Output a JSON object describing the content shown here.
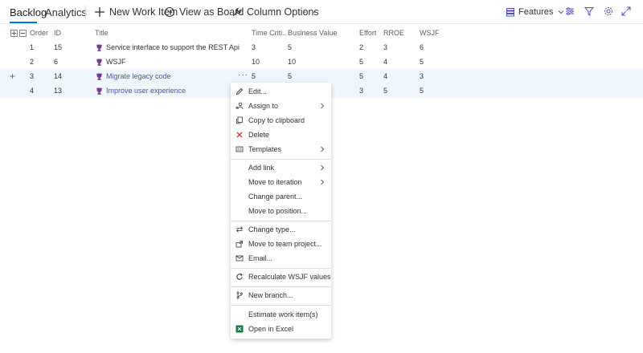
{
  "tabs": [
    {
      "label": "Backlog",
      "active": true
    },
    {
      "label": "Analytics",
      "active": false
    }
  ],
  "toolbar": {
    "new_work_item": "New Work Item",
    "view_as_board": "View as Board",
    "column_options": "Column Options",
    "more": "···",
    "features_label": "Features"
  },
  "columns": [
    "Order",
    "ID",
    "Title",
    "Time Criti...",
    "Business Value",
    "Effort",
    "RROE",
    "WSJF"
  ],
  "rows": [
    {
      "order": "1",
      "id": "15",
      "title": "Service interface to support the REST Api",
      "time": "3",
      "bv": "5",
      "effort": "2",
      "rroe": "3",
      "wsjf": "6",
      "selected": false
    },
    {
      "order": "2",
      "id": "6",
      "title": "WSJF",
      "time": "10",
      "bv": "10",
      "effort": "5",
      "rroe": "4",
      "wsjf": "5",
      "selected": false
    },
    {
      "order": "3",
      "id": "14",
      "title": "Migrate legacy code",
      "time": "5",
      "bv": "5",
      "effort": "5",
      "rroe": "4",
      "wsjf": "3",
      "selected": true
    },
    {
      "order": "4",
      "id": "13",
      "title": "Improve user experience",
      "time": "",
      "bv": "",
      "effort": "3",
      "rroe": "5",
      "wsjf": "5",
      "selected": true
    }
  ],
  "row_more": "···",
  "context_menu": {
    "items": [
      {
        "label": "Edit...",
        "icon": "pencil-icon"
      },
      {
        "label": "Assign to",
        "icon": "assign-icon",
        "submenu": true
      },
      {
        "label": "Copy to clipboard",
        "icon": "copy-icon"
      },
      {
        "label": "Delete",
        "icon": "delete-icon"
      },
      {
        "label": "Templates",
        "icon": "template-icon",
        "submenu": true
      },
      {
        "label": "Add link",
        "icon": "",
        "submenu": true
      },
      {
        "label": "Move to iteration",
        "icon": "",
        "submenu": true
      },
      {
        "label": "Change parent...",
        "icon": ""
      },
      {
        "label": "Move to position...",
        "icon": ""
      },
      {
        "label": "Change type...",
        "icon": "change-type-icon"
      },
      {
        "label": "Move to team project...",
        "icon": "move-project-icon"
      },
      {
        "label": "Email...",
        "icon": "email-icon"
      },
      {
        "label": "Recalculate WSJF values",
        "icon": "refresh-icon"
      },
      {
        "label": "New branch...",
        "icon": "branch-icon"
      },
      {
        "label": "Estimate work item(s)",
        "icon": ""
      },
      {
        "label": "Open in Excel",
        "icon": "excel-icon"
      }
    ]
  },
  "colors": {
    "accent": "#0078d4",
    "link": "#4f52b2",
    "trophy": "#773b93",
    "delete": "#d13438",
    "selected_row": "#eff6fc",
    "excel": "#107c41"
  }
}
